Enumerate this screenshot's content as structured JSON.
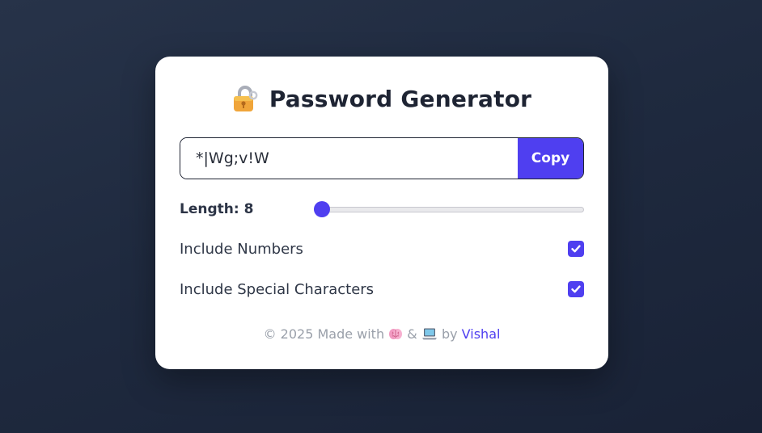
{
  "title": "Password Generator",
  "password": {
    "value": "*|Wg;v!W"
  },
  "copy_label": "Copy",
  "length": {
    "label": "Length: 8",
    "value": 8,
    "min": 8,
    "max": 32
  },
  "options": [
    {
      "label": "Include Numbers",
      "checked": true
    },
    {
      "label": "Include Special Characters",
      "checked": true
    }
  ],
  "footer": {
    "prefix": "© 2025 Made with",
    "amp": "&",
    "by": "by",
    "author": "Vishal"
  },
  "colors": {
    "accent": "#4f3ff0",
    "text_dark": "#1e2433",
    "footer_text": "#9aa0aa"
  },
  "icons": [
    "lock-icon",
    "brain-icon",
    "laptop-icon",
    "checkmark-icon"
  ]
}
